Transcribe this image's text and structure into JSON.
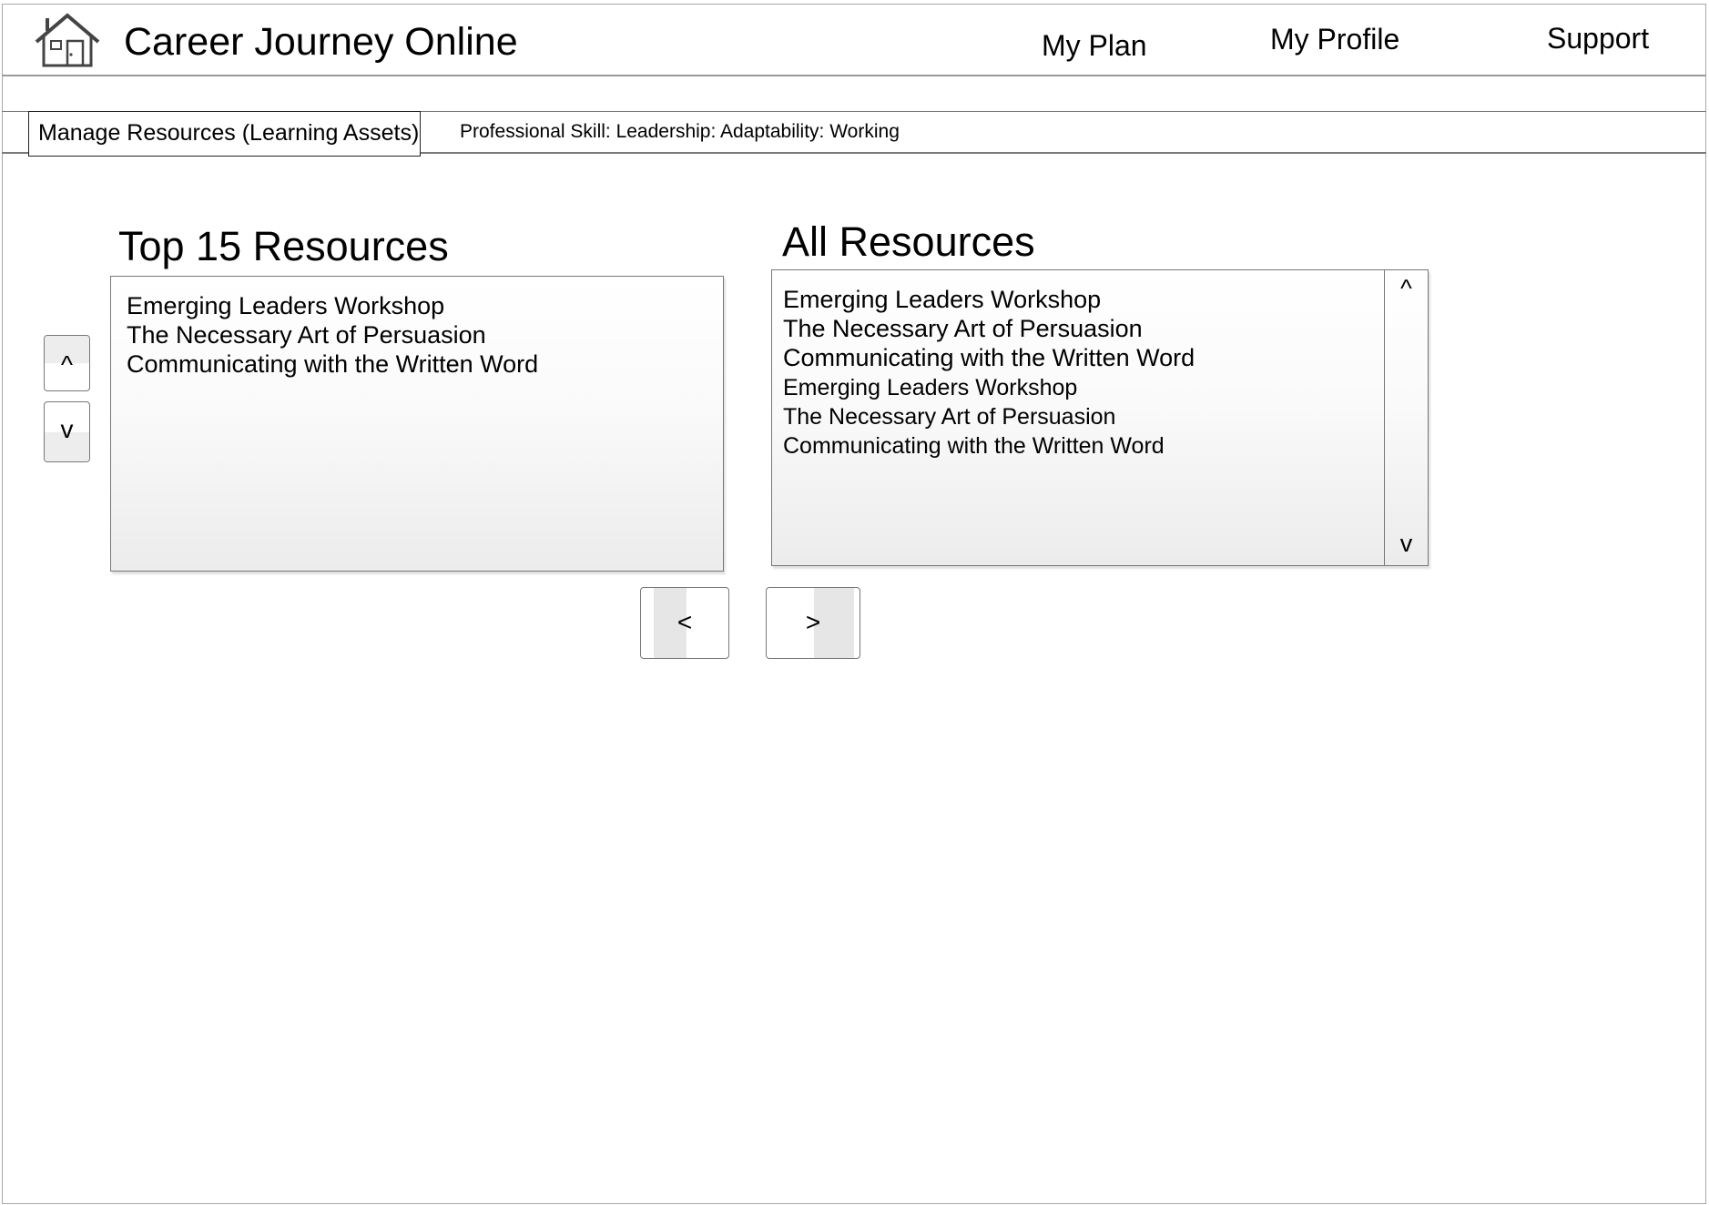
{
  "header": {
    "app_title": "Career Journey Online",
    "nav": {
      "my_plan": "My Plan",
      "my_profile": "My Profile",
      "support": "Support"
    }
  },
  "toolbar": {
    "manage_tab": "Manage Resources (Learning Assets)",
    "breadcrumb": "Professional Skill: Leadership: Adaptability: Working"
  },
  "top_resources": {
    "title": "Top 15 Resources",
    "items": [
      "Emerging Leaders Workshop",
      "The Necessary Art of Persuasion",
      "Communicating with the Written Word"
    ],
    "move_up": "^",
    "move_down": "v"
  },
  "all_resources": {
    "title": "All Resources",
    "items": [
      "Emerging Leaders Workshop",
      "The Necessary Art of Persuasion",
      "Communicating with the Written Word",
      "Emerging Leaders Workshop",
      "The Necessary Art of Persuasion",
      "Communicating with the Written Word"
    ],
    "scroll_up": "^",
    "scroll_down": "v"
  },
  "transfer": {
    "remove": "<",
    "add": ">"
  },
  "icons": {
    "home": "home-icon"
  }
}
